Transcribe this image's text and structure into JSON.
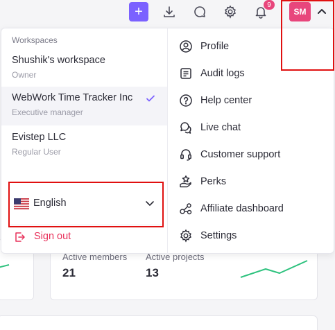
{
  "topbar": {
    "add_icon": "plus-icon",
    "notifications_count": "9",
    "avatar_initials": "SM"
  },
  "dropdown": {
    "workspaces_heading": "Workspaces",
    "workspaces": [
      {
        "name": "Shushik's workspace",
        "role": "Owner",
        "active": false
      },
      {
        "name": "WebWork Time Tracker Inc",
        "role": "Executive manager",
        "active": true
      },
      {
        "name": "Evistep LLC",
        "role": "Regular User",
        "active": false
      }
    ],
    "language": "English",
    "sign_out": "Sign out",
    "menu": [
      {
        "label": "Profile",
        "icon": "user-circle-icon"
      },
      {
        "label": "Audit logs",
        "icon": "document-list-icon"
      },
      {
        "label": "Help center",
        "icon": "help-circle-icon"
      },
      {
        "label": "Live chat",
        "icon": "chat-bubbles-icon"
      },
      {
        "label": "Customer support",
        "icon": "headset-icon"
      },
      {
        "label": "Perks",
        "icon": "hand-star-icon"
      },
      {
        "label": "Affiliate dashboard",
        "icon": "affiliate-network-icon"
      },
      {
        "label": "Settings",
        "icon": "gear-icon"
      }
    ]
  },
  "background": {
    "stats": [
      {
        "label": "Active members",
        "value": "21"
      },
      {
        "label": "Active projects",
        "value": "13"
      }
    ]
  },
  "colors": {
    "accent": "#7b61ff",
    "badge": "#e8467c",
    "danger": "#e8305a",
    "highlight": "#e01010",
    "sparkline": "#2ec27e"
  }
}
